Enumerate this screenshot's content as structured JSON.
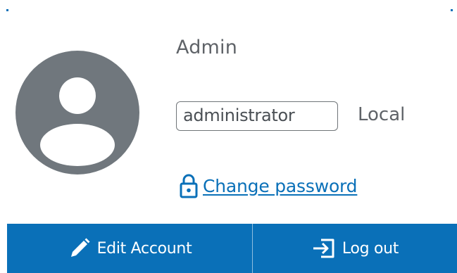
{
  "user": {
    "name": "Admin",
    "role": "administrator",
    "auth_type": "Local"
  },
  "links": {
    "change_password": "Change password"
  },
  "actions": {
    "edit_account": "Edit Account",
    "log_out": "Log out"
  },
  "colors": {
    "accent": "#0a70b8",
    "avatar": "#70777d",
    "text_muted": "#5f6368"
  },
  "icons": {
    "avatar": "user-avatar-icon",
    "lock": "lock-icon",
    "edit": "pencil-icon",
    "logout": "logout-icon"
  }
}
